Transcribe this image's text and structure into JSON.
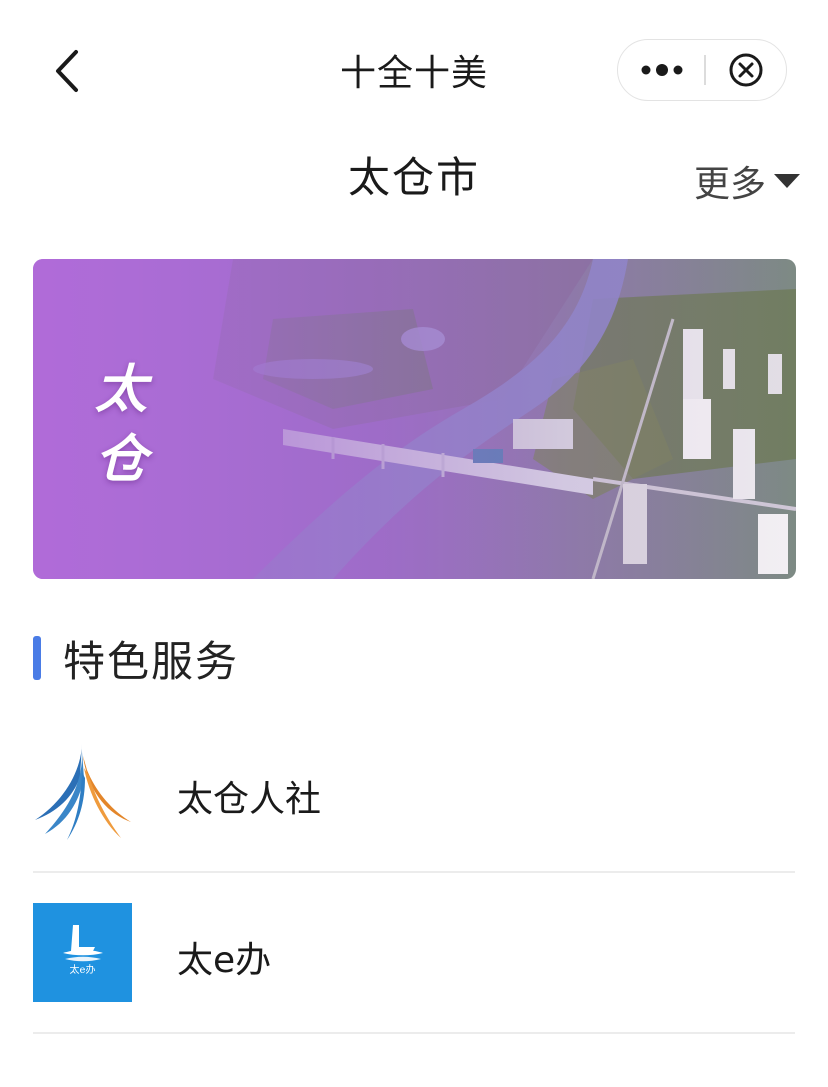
{
  "nav": {
    "title": "十全十美"
  },
  "header": {
    "city": "太仓市",
    "more_label": "更多"
  },
  "banner": {
    "calligraphy": [
      "太",
      "仓"
    ]
  },
  "section": {
    "title": "特色服务"
  },
  "services": [
    {
      "label": "太仓人社",
      "icon": "taicang-hr-logo-icon"
    },
    {
      "label": "太e办",
      "icon": "tai-e-ban-logo-icon",
      "logo_text": "太e办"
    }
  ],
  "colors": {
    "accent": "#4a7ce6",
    "eban_blue": "#1f92e0",
    "banner_purple": "#a96bd6"
  }
}
